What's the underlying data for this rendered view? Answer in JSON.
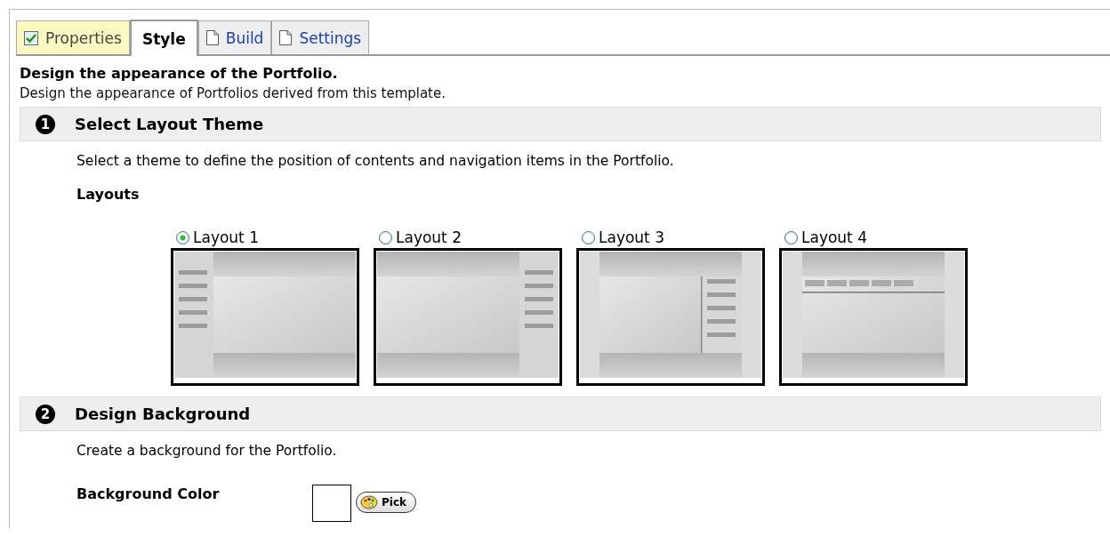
{
  "tabs": [
    {
      "label": "Properties",
      "kind": "checked",
      "selected": false
    },
    {
      "label": "Style",
      "kind": "plain",
      "selected": true
    },
    {
      "label": "Build",
      "kind": "page",
      "selected": false
    },
    {
      "label": "Settings",
      "kind": "page",
      "selected": false
    }
  ],
  "page_title": "Design the appearance of the Portfolio.",
  "page_description": "Design the appearance of Portfolios derived from this template.",
  "sections": [
    {
      "number": "1",
      "title": "Select Layout Theme",
      "description": "Select a theme to define the position of contents and navigation items in the Portfolio.",
      "kind": "layouts",
      "label": "Layouts",
      "layouts": [
        {
          "label": "Layout 1",
          "kind": "left-nav",
          "selected": true
        },
        {
          "label": "Layout 2",
          "kind": "right-nav",
          "selected": false
        },
        {
          "label": "Layout 3",
          "kind": "inner-right-nav",
          "selected": false
        },
        {
          "label": "Layout 4",
          "kind": "top-nav",
          "selected": false
        }
      ]
    },
    {
      "number": "2",
      "title": "Design Background",
      "description": "Create a background for the Portfolio.",
      "kind": "color",
      "label": "Background Color",
      "button": "Pick"
    }
  ]
}
